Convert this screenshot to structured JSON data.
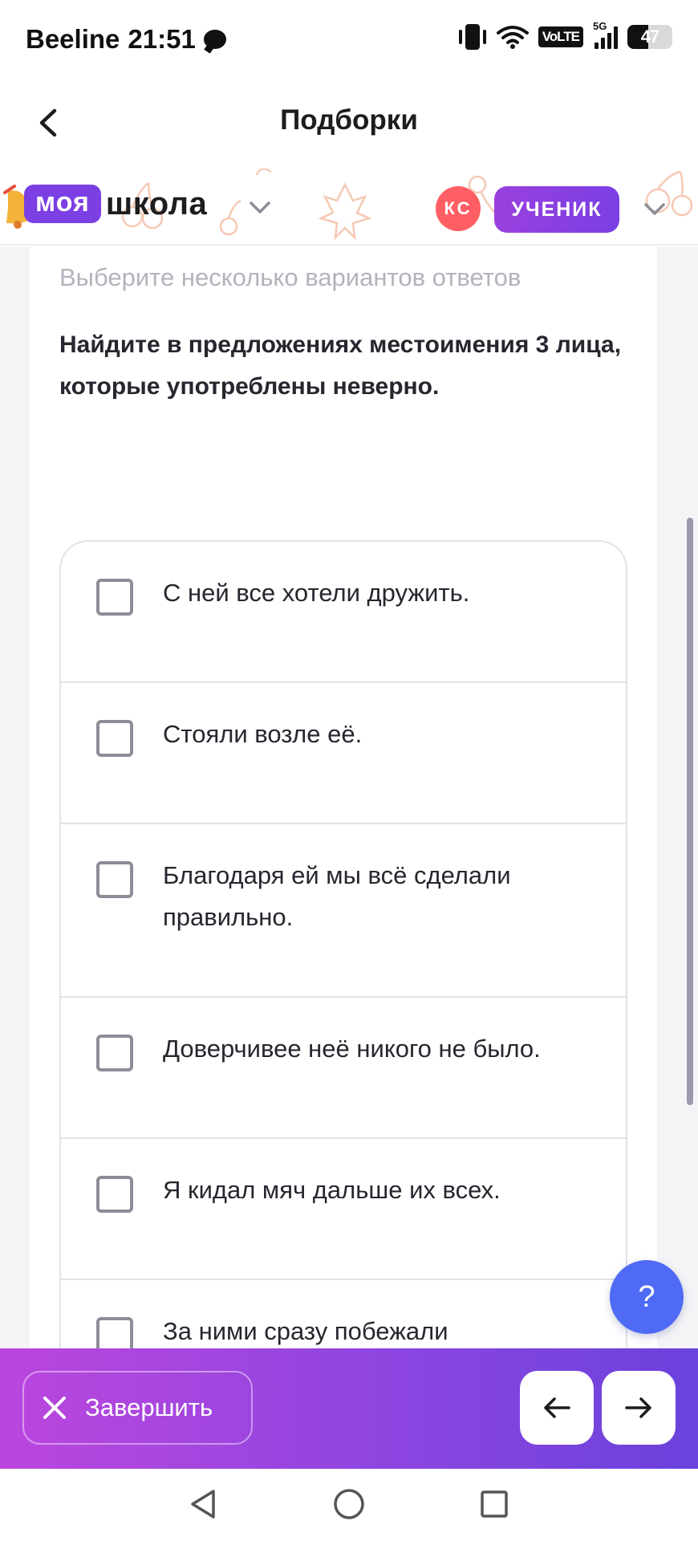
{
  "status_bar": {
    "carrier": "Beeline",
    "time": "21:51",
    "network_badge": "VoLTE",
    "network_type": "5G",
    "battery": "47",
    "battery_level": 0.47,
    "icons": [
      "chat-icon",
      "vibrate-icon",
      "wifi-icon",
      "volte-icon",
      "signal-icon",
      "battery-icon"
    ]
  },
  "header": {
    "title": "Подборки",
    "back_icon": "chevron-left-icon"
  },
  "brand": {
    "logo_part1": "моя",
    "logo_part2": "школа",
    "avatar_initials": "КС",
    "role": "УЧЕНИК",
    "accent_color": "#7b3fe4",
    "avatar_color": "#ff5f64"
  },
  "task": {
    "instruction": "Выберите несколько вариантов ответов",
    "question": "Найдите в предложениях местоимения 3 лица, которые употреблены неверно.",
    "options": [
      {
        "label": "С ней все хотели дружить.",
        "checked": false
      },
      {
        "label": "Стояли возле её.",
        "checked": false
      },
      {
        "label": "Благодаря ей мы всё сделали правильно.",
        "checked": false
      },
      {
        "label": "Доверчивее неё никого не было.",
        "checked": false
      },
      {
        "label": "Я кидал мяч дальше их всех.",
        "checked": false
      },
      {
        "label": "За ними сразу побежали",
        "checked": false
      }
    ]
  },
  "help": {
    "label": "?",
    "color": "#4f6af5"
  },
  "actions": {
    "finish_label": "Завершить",
    "prev_icon": "arrow-left-icon",
    "next_icon": "arrow-right-icon"
  },
  "system_nav": [
    "back-triangle-icon",
    "home-circle-icon",
    "recents-square-icon"
  ]
}
